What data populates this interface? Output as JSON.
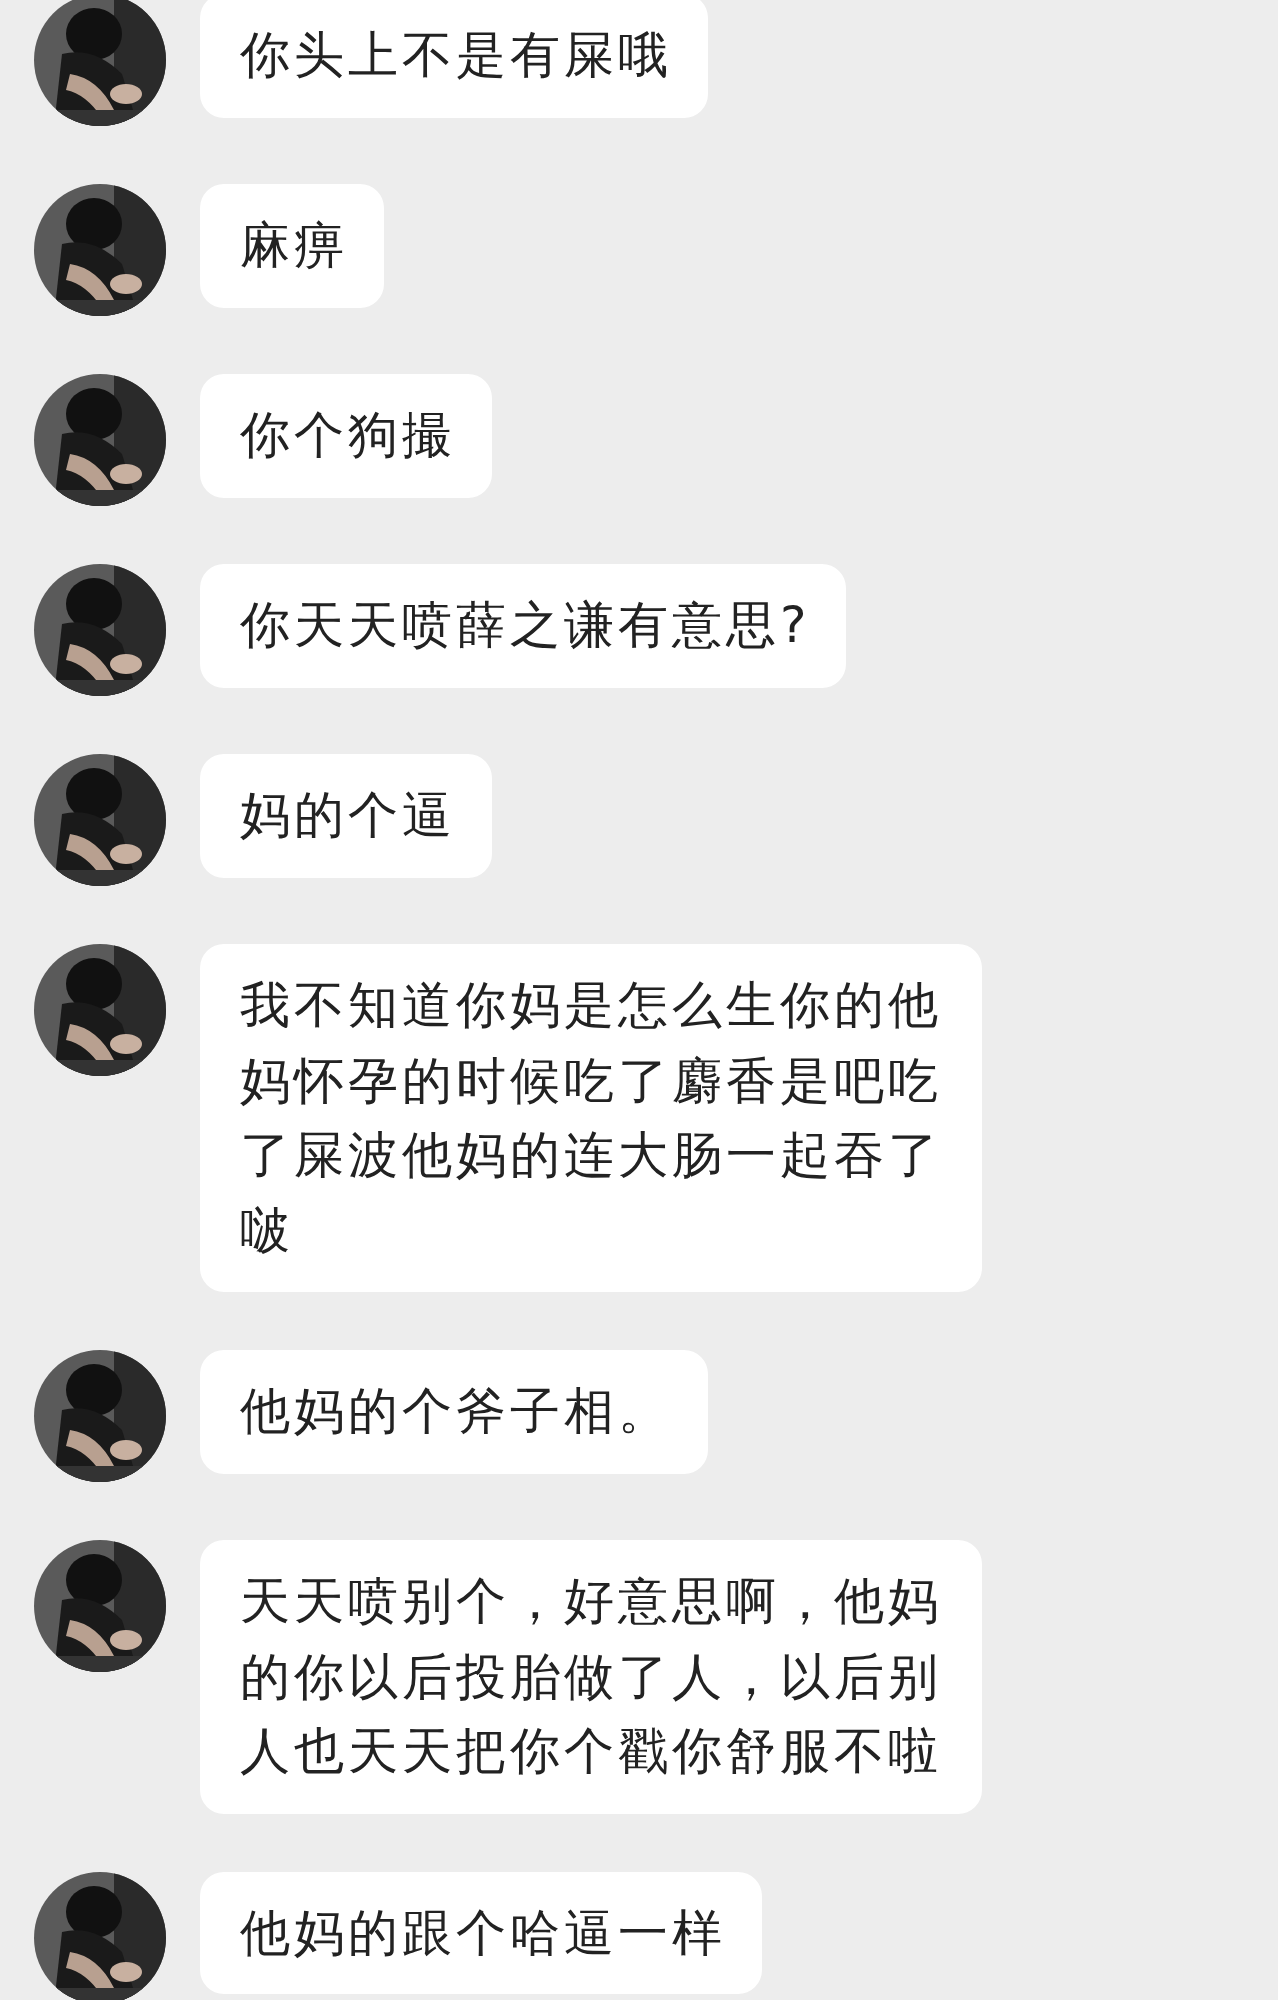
{
  "messages": [
    {
      "text": "你头上不是有屎哦"
    },
    {
      "text": "麻痹"
    },
    {
      "text": "你个狗撮"
    },
    {
      "text": "你天天喷薛之谦有意思?"
    },
    {
      "text": "妈的个逼"
    },
    {
      "text": "我不知道你妈是怎么生你的他妈怀孕的时候吃了麝香是吧吃了屎波他妈的连大肠一起吞了啵"
    },
    {
      "text": "他妈的个斧子相。"
    },
    {
      "text": "天天喷别个，好意思啊，他妈的你以后投胎做了人，以后别人也天天把你个戳你舒服不啦"
    },
    {
      "text": "他妈的跟个哈逼一样"
    }
  ]
}
